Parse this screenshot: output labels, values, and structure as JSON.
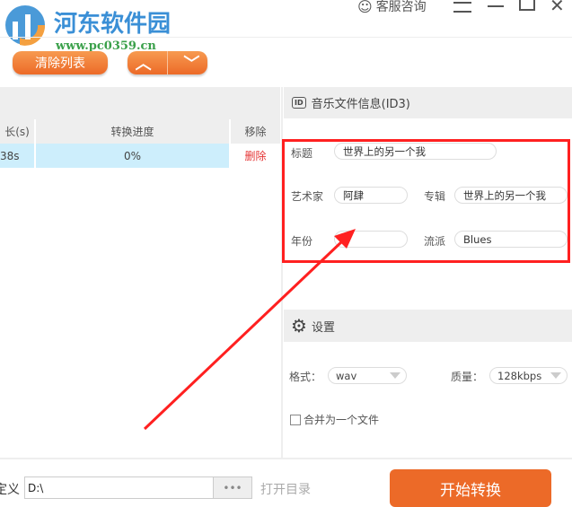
{
  "watermark": {
    "name": "河东软件园",
    "url": "www.pc0359.cn"
  },
  "titlebar": {
    "support": "客服咨询"
  },
  "toolbar": {
    "clear_list": "清除列表"
  },
  "table": {
    "headers": [
      "长(s)",
      "转换进度",
      "移除"
    ],
    "rows": [
      {
        "duration": "38s",
        "progress": "0%",
        "remove": "删除"
      }
    ]
  },
  "id3": {
    "title": "音乐文件信息(ID3)",
    "icon_text": "ID",
    "fields": {
      "title_label": "标题",
      "title_value": "世界上的另一个我",
      "artist_label": "艺术家",
      "artist_value": "阿肆",
      "album_label": "专辑",
      "album_value": "世界上的另一个我",
      "year_label": "年份",
      "year_value": "",
      "genre_label": "流派",
      "genre_value": "Blues"
    }
  },
  "settings": {
    "title": "设置",
    "format_label": "格式：",
    "format_value": "wav",
    "quality_label": "质量：",
    "quality_value": "128kbps",
    "merge_label": "合并为一个文件"
  },
  "bottom": {
    "path_label": "定义",
    "path_value": "D:\\",
    "browse": "•••",
    "open_dir": "打开目录",
    "start": "开始转换"
  },
  "colors": {
    "accent": "#ec6a28",
    "highlight": "#cdeefc",
    "annotation": "#ff2020"
  }
}
